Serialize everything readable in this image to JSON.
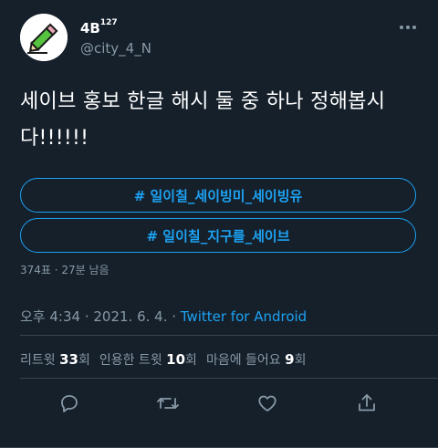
{
  "user": {
    "display_name": "4B",
    "display_name_sup": "127",
    "handle": "@city_4_N"
  },
  "tweet": {
    "text_line1": "세이브 홍보 한글 해시 둘 중 하나 정해봅시",
    "text_line2": "다!!!!!!"
  },
  "poll": {
    "options": [
      {
        "label": "# 일이칠_세이빙미_세이빙유"
      },
      {
        "label": "# 일이칠_지구를_세이브"
      }
    ],
    "meta": "374표 · 27분 남음"
  },
  "timestamp": {
    "time_date": "오후 4:34 · 2021. 6. 4. · ",
    "client": "Twitter for Android"
  },
  "stats": {
    "retweets_label": "리트윗",
    "retweets_count": "33",
    "retweets_suffix": "회",
    "quotes_label": "인용한 트윗",
    "quotes_count": "10",
    "quotes_suffix": "회",
    "likes_label": "마음에 들어요",
    "likes_count": "9",
    "likes_suffix": "회"
  },
  "icons": {
    "avatar": "pencil-icon",
    "more": "more-icon",
    "reply": "reply-icon",
    "retweet": "retweet-icon",
    "like": "heart-icon",
    "share": "share-icon"
  },
  "colors": {
    "background": "#15202b",
    "accent": "#1da1f2",
    "secondary_text": "#8899a6",
    "divider": "#38444d"
  }
}
